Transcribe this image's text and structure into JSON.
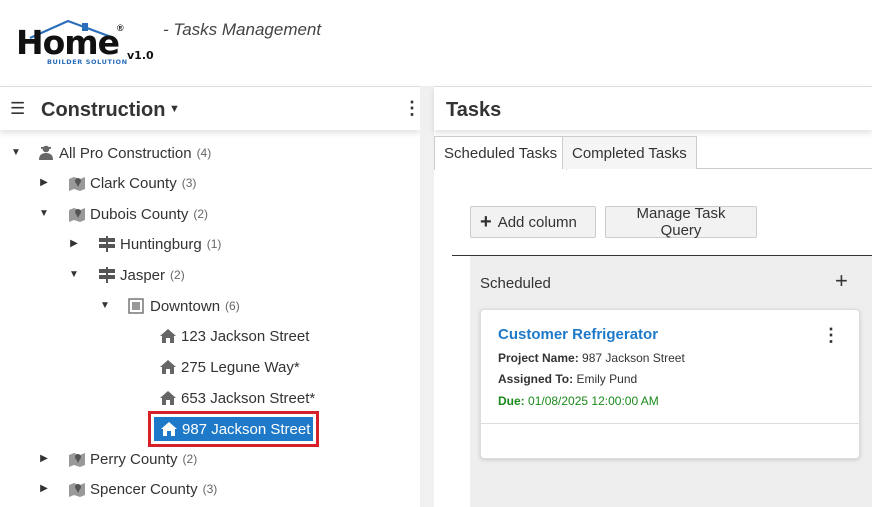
{
  "header": {
    "logo_word": "Home",
    "logo_tagline": "BUILDER SOLUTION",
    "logo_reg": "®",
    "version": "v1.0",
    "subtitle": "- Tasks Management"
  },
  "left_panel": {
    "title": "Construction",
    "tree": [
      {
        "label": "All Pro Construction",
        "count": "(4)",
        "icon": "user-icon",
        "expanded": true
      },
      {
        "label": "Clark County",
        "count": "(3)",
        "icon": "map-icon",
        "expanded": false
      },
      {
        "label": "Dubois County",
        "count": "(2)",
        "icon": "map-icon",
        "expanded": true
      },
      {
        "label": "Huntingburg",
        "count": "(1)",
        "icon": "signpost-icon",
        "expanded": false
      },
      {
        "label": "Jasper",
        "count": "(2)",
        "icon": "signpost-icon",
        "expanded": true
      },
      {
        "label": "Downtown",
        "count": "(6)",
        "icon": "area-icon",
        "expanded": true
      },
      {
        "label": "123 Jackson Street",
        "count": "",
        "icon": "house-icon"
      },
      {
        "label": "275 Legune Way*",
        "count": "",
        "icon": "house-icon"
      },
      {
        "label": "653 Jackson Street*",
        "count": "",
        "icon": "house-icon"
      },
      {
        "label": "987 Jackson Street",
        "count": "",
        "icon": "house-icon",
        "selected": true
      },
      {
        "label": "Perry County",
        "count": "(2)",
        "icon": "map-icon",
        "expanded": false
      },
      {
        "label": "Spencer County",
        "count": "(3)",
        "icon": "map-icon",
        "expanded": false
      }
    ]
  },
  "right_panel": {
    "title": "Tasks",
    "tabs": [
      {
        "label": "Scheduled Tasks",
        "active": true
      },
      {
        "label": "Completed Tasks",
        "active": false
      }
    ],
    "buttons": {
      "add_column": "Add column",
      "manage_query": "Manage Task Query"
    },
    "column": {
      "title": "Scheduled",
      "card": {
        "title": "Customer Refrigerator",
        "project_label": "Project Name:",
        "project_value": "987 Jackson Street",
        "assigned_label": "Assigned To:",
        "assigned_value": "Emily Pund",
        "due_label": "Due:",
        "due_value": "01/08/2025 12:00:00 AM"
      }
    }
  },
  "colors": {
    "accent": "#1e7ac8",
    "selection_border": "#d6202a",
    "due": "#1a8a1a"
  }
}
